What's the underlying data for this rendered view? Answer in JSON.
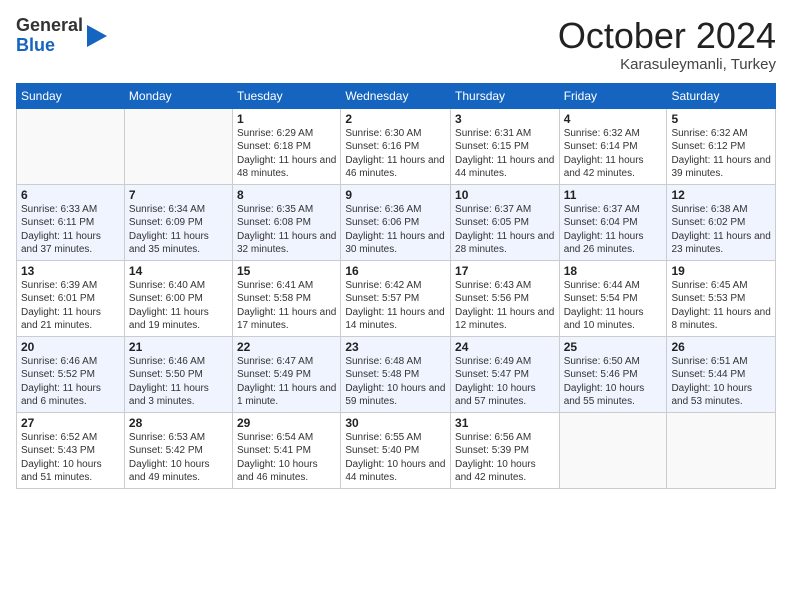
{
  "header": {
    "logo_line1": "General",
    "logo_line2": "Blue",
    "month": "October 2024",
    "location": "Karasuleymanli, Turkey"
  },
  "days_of_week": [
    "Sunday",
    "Monday",
    "Tuesday",
    "Wednesday",
    "Thursday",
    "Friday",
    "Saturday"
  ],
  "weeks": [
    [
      {
        "day": "",
        "text": ""
      },
      {
        "day": "",
        "text": ""
      },
      {
        "day": "1",
        "text": "Sunrise: 6:29 AM\nSunset: 6:18 PM\nDaylight: 11 hours and 48 minutes."
      },
      {
        "day": "2",
        "text": "Sunrise: 6:30 AM\nSunset: 6:16 PM\nDaylight: 11 hours and 46 minutes."
      },
      {
        "day": "3",
        "text": "Sunrise: 6:31 AM\nSunset: 6:15 PM\nDaylight: 11 hours and 44 minutes."
      },
      {
        "day": "4",
        "text": "Sunrise: 6:32 AM\nSunset: 6:14 PM\nDaylight: 11 hours and 42 minutes."
      },
      {
        "day": "5",
        "text": "Sunrise: 6:32 AM\nSunset: 6:12 PM\nDaylight: 11 hours and 39 minutes."
      }
    ],
    [
      {
        "day": "6",
        "text": "Sunrise: 6:33 AM\nSunset: 6:11 PM\nDaylight: 11 hours and 37 minutes."
      },
      {
        "day": "7",
        "text": "Sunrise: 6:34 AM\nSunset: 6:09 PM\nDaylight: 11 hours and 35 minutes."
      },
      {
        "day": "8",
        "text": "Sunrise: 6:35 AM\nSunset: 6:08 PM\nDaylight: 11 hours and 32 minutes."
      },
      {
        "day": "9",
        "text": "Sunrise: 6:36 AM\nSunset: 6:06 PM\nDaylight: 11 hours and 30 minutes."
      },
      {
        "day": "10",
        "text": "Sunrise: 6:37 AM\nSunset: 6:05 PM\nDaylight: 11 hours and 28 minutes."
      },
      {
        "day": "11",
        "text": "Sunrise: 6:37 AM\nSunset: 6:04 PM\nDaylight: 11 hours and 26 minutes."
      },
      {
        "day": "12",
        "text": "Sunrise: 6:38 AM\nSunset: 6:02 PM\nDaylight: 11 hours and 23 minutes."
      }
    ],
    [
      {
        "day": "13",
        "text": "Sunrise: 6:39 AM\nSunset: 6:01 PM\nDaylight: 11 hours and 21 minutes."
      },
      {
        "day": "14",
        "text": "Sunrise: 6:40 AM\nSunset: 6:00 PM\nDaylight: 11 hours and 19 minutes."
      },
      {
        "day": "15",
        "text": "Sunrise: 6:41 AM\nSunset: 5:58 PM\nDaylight: 11 hours and 17 minutes."
      },
      {
        "day": "16",
        "text": "Sunrise: 6:42 AM\nSunset: 5:57 PM\nDaylight: 11 hours and 14 minutes."
      },
      {
        "day": "17",
        "text": "Sunrise: 6:43 AM\nSunset: 5:56 PM\nDaylight: 11 hours and 12 minutes."
      },
      {
        "day": "18",
        "text": "Sunrise: 6:44 AM\nSunset: 5:54 PM\nDaylight: 11 hours and 10 minutes."
      },
      {
        "day": "19",
        "text": "Sunrise: 6:45 AM\nSunset: 5:53 PM\nDaylight: 11 hours and 8 minutes."
      }
    ],
    [
      {
        "day": "20",
        "text": "Sunrise: 6:46 AM\nSunset: 5:52 PM\nDaylight: 11 hours and 6 minutes."
      },
      {
        "day": "21",
        "text": "Sunrise: 6:46 AM\nSunset: 5:50 PM\nDaylight: 11 hours and 3 minutes."
      },
      {
        "day": "22",
        "text": "Sunrise: 6:47 AM\nSunset: 5:49 PM\nDaylight: 11 hours and 1 minute."
      },
      {
        "day": "23",
        "text": "Sunrise: 6:48 AM\nSunset: 5:48 PM\nDaylight: 10 hours and 59 minutes."
      },
      {
        "day": "24",
        "text": "Sunrise: 6:49 AM\nSunset: 5:47 PM\nDaylight: 10 hours and 57 minutes."
      },
      {
        "day": "25",
        "text": "Sunrise: 6:50 AM\nSunset: 5:46 PM\nDaylight: 10 hours and 55 minutes."
      },
      {
        "day": "26",
        "text": "Sunrise: 6:51 AM\nSunset: 5:44 PM\nDaylight: 10 hours and 53 minutes."
      }
    ],
    [
      {
        "day": "27",
        "text": "Sunrise: 6:52 AM\nSunset: 5:43 PM\nDaylight: 10 hours and 51 minutes."
      },
      {
        "day": "28",
        "text": "Sunrise: 6:53 AM\nSunset: 5:42 PM\nDaylight: 10 hours and 49 minutes."
      },
      {
        "day": "29",
        "text": "Sunrise: 6:54 AM\nSunset: 5:41 PM\nDaylight: 10 hours and 46 minutes."
      },
      {
        "day": "30",
        "text": "Sunrise: 6:55 AM\nSunset: 5:40 PM\nDaylight: 10 hours and 44 minutes."
      },
      {
        "day": "31",
        "text": "Sunrise: 6:56 AM\nSunset: 5:39 PM\nDaylight: 10 hours and 42 minutes."
      },
      {
        "day": "",
        "text": ""
      },
      {
        "day": "",
        "text": ""
      }
    ]
  ]
}
